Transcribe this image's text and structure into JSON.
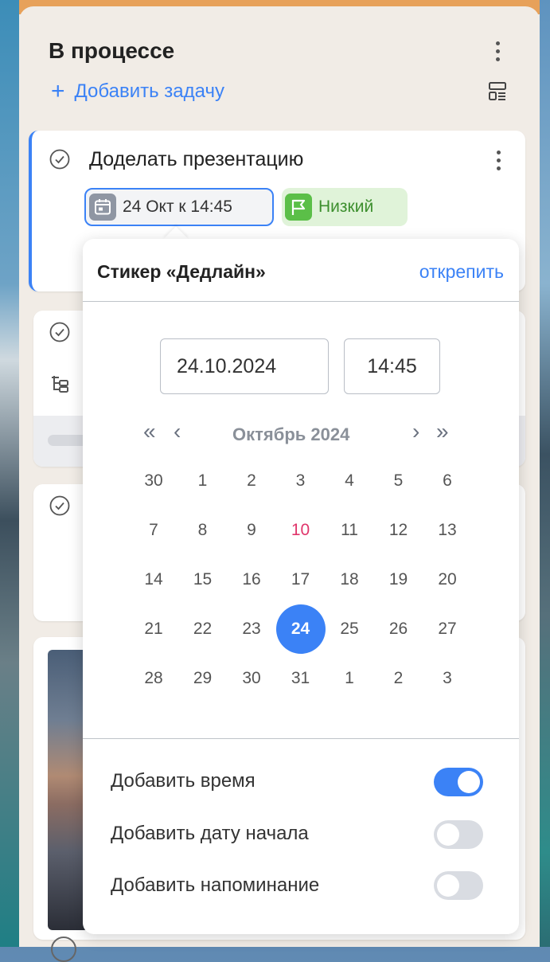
{
  "column": {
    "title": "В процессе",
    "add_task_label": "Добавить задачу"
  },
  "task": {
    "title": "Доделать презентацию",
    "deadline_chip": "24 Окт к 14:45",
    "priority_chip": "Низкий"
  },
  "popup": {
    "title": "Стикер «Дедлайн»",
    "unpin_label": "открепить",
    "date_value": "24.10.2024",
    "time_value": "14:45",
    "month_label": "Октябрь 2024",
    "nav": {
      "prev_year": "«",
      "prev_month": "‹",
      "next_month": "›",
      "next_year": "»"
    },
    "weeks": [
      [
        "30",
        "1",
        "2",
        "3",
        "4",
        "5",
        "6"
      ],
      [
        "7",
        "8",
        "9",
        "10",
        "11",
        "12",
        "13"
      ],
      [
        "14",
        "15",
        "16",
        "17",
        "18",
        "19",
        "20"
      ],
      [
        "21",
        "22",
        "23",
        "24",
        "25",
        "26",
        "27"
      ],
      [
        "28",
        "29",
        "30",
        "31",
        "1",
        "2",
        "3"
      ]
    ],
    "today_day": "10",
    "selected_day": "24",
    "options": [
      {
        "label": "Добавить время",
        "enabled": true
      },
      {
        "label": "Добавить дату начала",
        "enabled": false
      },
      {
        "label": "Добавить напоминание",
        "enabled": false
      }
    ]
  },
  "colors": {
    "accent": "#3b82f6",
    "today": "#e0356b",
    "priority": "#5bbf48"
  }
}
